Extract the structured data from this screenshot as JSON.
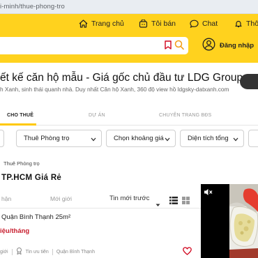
{
  "browser": {
    "url": "i-minh/thue-phong-tro"
  },
  "header": {
    "nav": [
      {
        "label": "Trang chủ",
        "icon": "home-icon"
      },
      {
        "label": "Tôi bán",
        "icon": "seller-icon"
      },
      {
        "label": "Chat",
        "icon": "chat-icon"
      },
      {
        "label": "Thô",
        "icon": "bell-icon"
      }
    ],
    "search": {
      "placeholder": ""
    },
    "login_label": "Đăng nhập"
  },
  "ad": {
    "title": "ết kế căn hộ mẫu - Giá gốc chủ đầu tư LDG Group",
    "subtitle": "h Xanh, sinh thái quanh nhà. Duy nhất Căn hộ Xanh, 360 độ view hồ ldgsky-datxanh.com"
  },
  "tabs": [
    {
      "label": "CHO THUÊ",
      "active": true
    },
    {
      "label": "DỰ ÁN",
      "active": false
    },
    {
      "label": "CHUYÊN TRANG BĐS",
      "active": false
    }
  ],
  "filters": [
    {
      "label": "Thuê Phòng trọ"
    },
    {
      "label": "Chọn khoảng giá"
    },
    {
      "label": "Diện tích tổng"
    }
  ],
  "breadcrumb": "Thuê Phòng trọ",
  "heading": "TP.HCM Giá Rẻ",
  "sort": {
    "tabs": [
      "hận",
      "Mới giới"
    ],
    "selected": "Tin mới trước"
  },
  "listing": {
    "title": "Quận Bình Thạnh 25m²",
    "price": "iệu/tháng",
    "meta": [
      "giới",
      "Tin ưu tiên",
      "Quận Bình Thạnh"
    ]
  },
  "colors": {
    "brand_yellow": "#ffd21e",
    "tab_underline": "#ffc800",
    "price_red": "#c81e2e"
  }
}
